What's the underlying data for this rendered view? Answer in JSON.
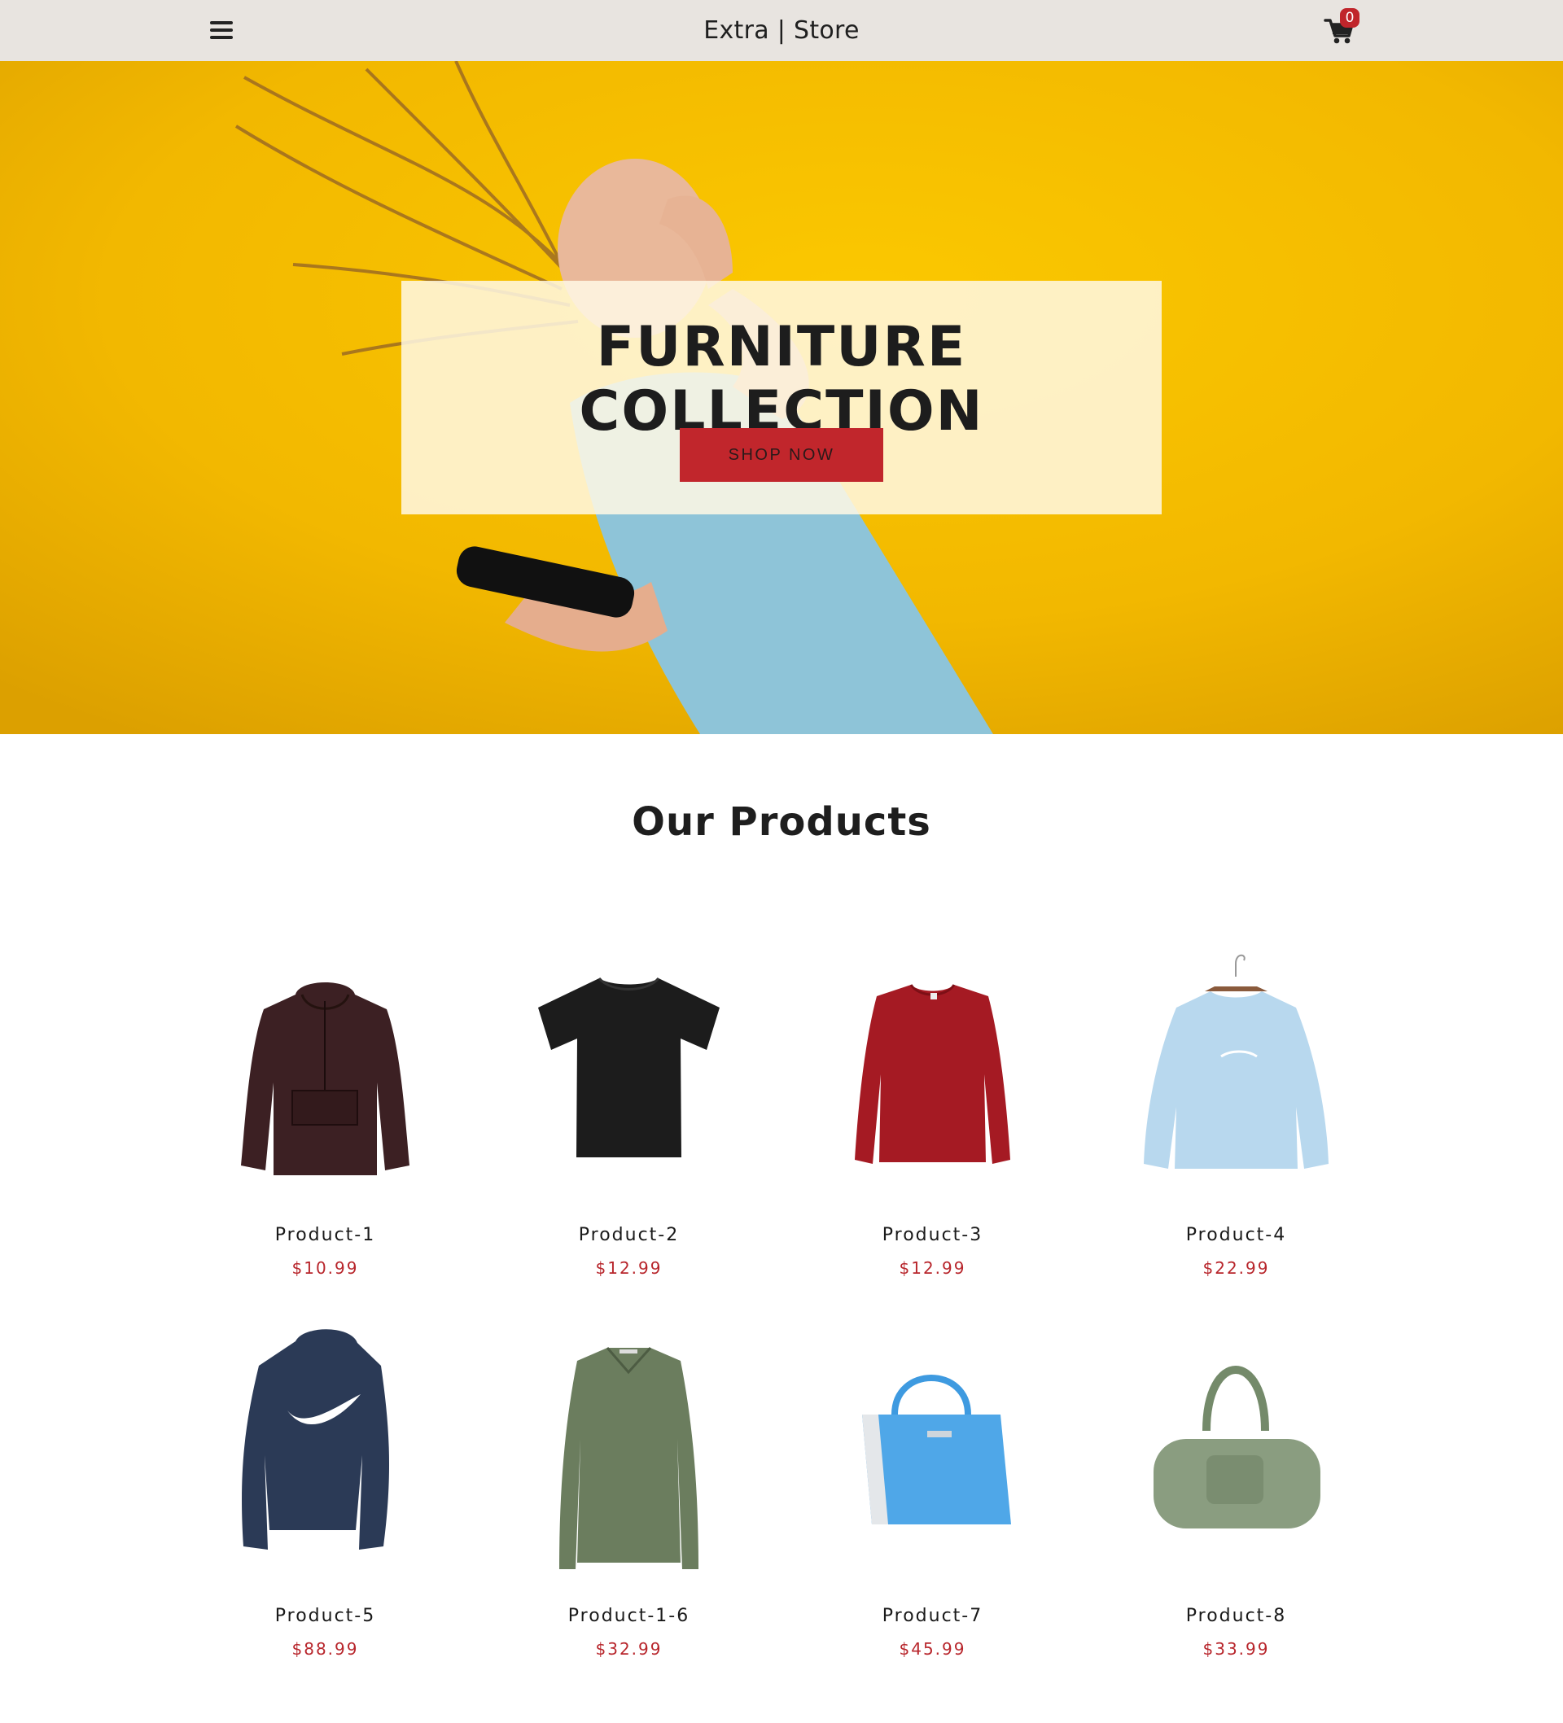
{
  "navbar": {
    "brand": "Extra | Store",
    "cart_count": "0",
    "menu_icon": "hamburger-menu-icon",
    "cart_icon": "shopping-cart-icon"
  },
  "hero": {
    "title": "FURNITURE COLLECTION",
    "button_label": "SHOP NOW",
    "background_color": "#f2b800",
    "button_color": "#c1262c"
  },
  "products_section": {
    "title": "Our Products",
    "items": [
      {
        "name": "Product-1",
        "price": "$10.99",
        "image": "maroon-hoodie"
      },
      {
        "name": "Product-2",
        "price": "$12.99",
        "image": "black-tshirt"
      },
      {
        "name": "Product-3",
        "price": "$12.99",
        "image": "red-sweatshirt"
      },
      {
        "name": "Product-4",
        "price": "$22.99",
        "image": "light-blue-sweatshirt"
      },
      {
        "name": "Product-5",
        "price": "$88.99",
        "image": "navy-hoodie"
      },
      {
        "name": "Product-1-6",
        "price": "$32.99",
        "image": "olive-polo-sweater"
      },
      {
        "name": "Product-7",
        "price": "$45.99",
        "image": "blue-handbag"
      },
      {
        "name": "Product-8",
        "price": "$33.99",
        "image": "green-duffel-bag"
      }
    ]
  },
  "colors": {
    "navbar_bg": "#e8e4e0",
    "accent": "#c1262c",
    "price": "#b8262c"
  }
}
